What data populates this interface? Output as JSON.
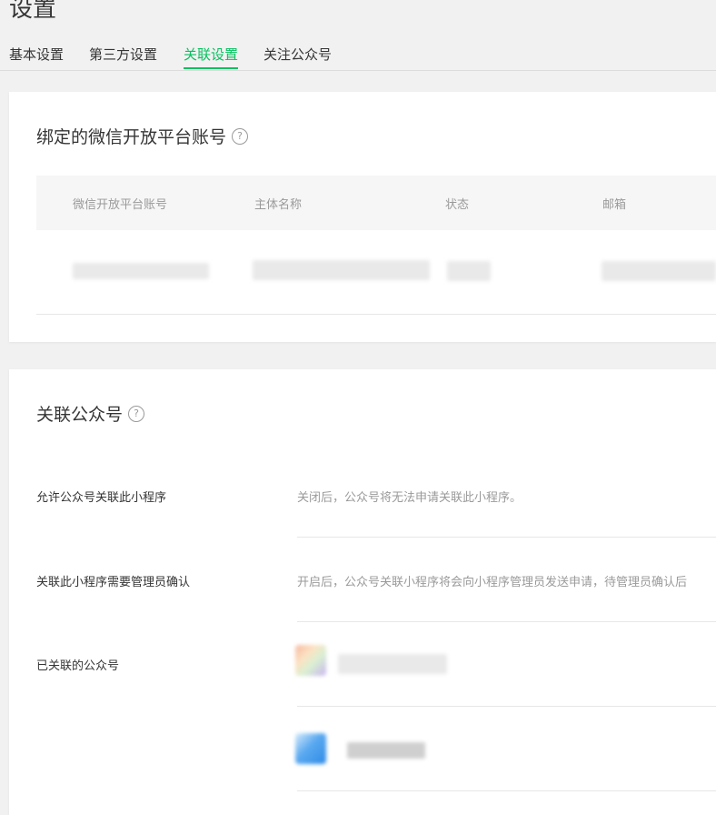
{
  "page": {
    "title": "设置"
  },
  "tabs": [
    {
      "label": "基本设置",
      "active": false
    },
    {
      "label": "第三方设置",
      "active": false
    },
    {
      "label": "关联设置",
      "active": true
    },
    {
      "label": "关注公众号",
      "active": false
    }
  ],
  "bound_account": {
    "title": "绑定的微信开放平台账号",
    "help_icon": "question-mark-icon",
    "columns": [
      "微信开放平台账号",
      "主体名称",
      "状态",
      "邮箱"
    ]
  },
  "linked_official_accounts": {
    "title": "关联公众号",
    "help_icon": "question-mark-icon",
    "rows": [
      {
        "label": "允许公众号关联此小程序",
        "desc": "关闭后，公众号将无法申请关联此小程序。"
      },
      {
        "label": "关联此小程序需要管理员确认",
        "desc": "开启后，公众号关联小程序将会向小程序管理员发送申请，待管理员确认后"
      },
      {
        "label": "已关联的公众号",
        "desc": ""
      }
    ]
  },
  "colors": {
    "accent": "#07c160",
    "muted": "#9a9a9a"
  }
}
